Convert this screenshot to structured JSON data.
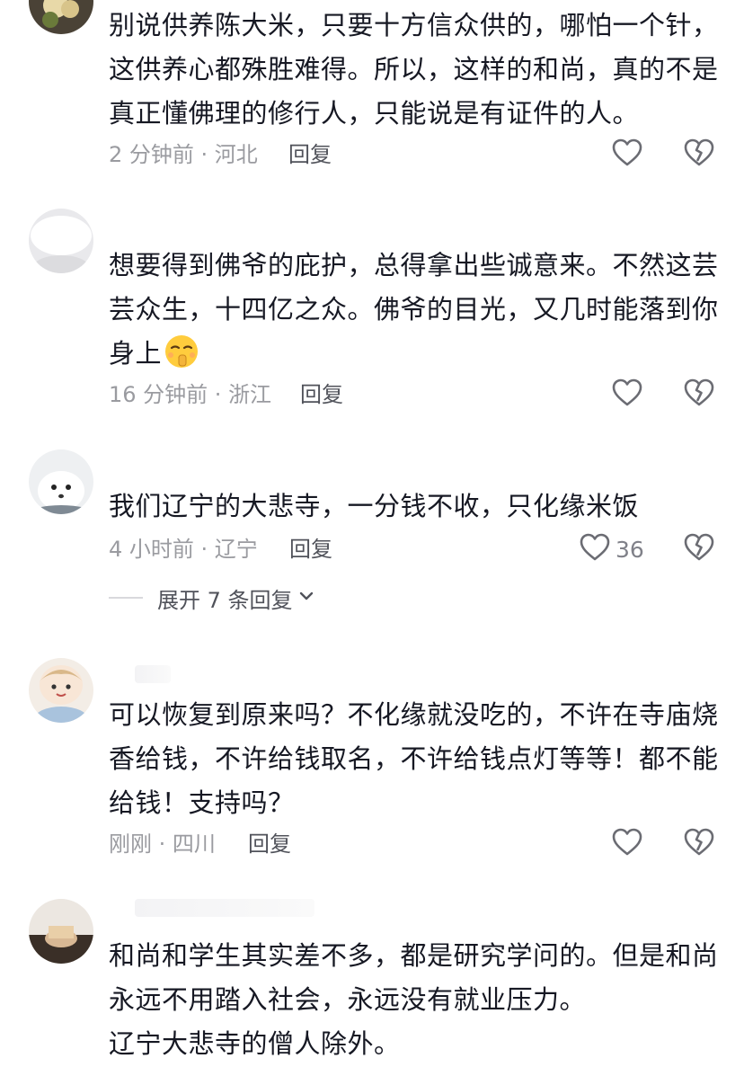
{
  "comments": [
    {
      "lines": [
        "别说供养陈大米，只要十方信众供的，哪怕一个针，",
        "这供养心都殊胜难得。所以，这样的和尚，真的不是",
        "真正懂佛理的修行人，只能说是有证件的人。"
      ],
      "time": "2 分钟前",
      "location": "河北",
      "reply_label": "回复",
      "like_count": ""
    },
    {
      "lines": [
        "想要得到佛爷的庇护，总得拿出些诚意来。不然这芸",
        "芸众生，十四亿之众。佛爷的目光，又几时能落到你",
        "身上"
      ],
      "emoji": "shushing-face-emoji",
      "time": "16 分钟前",
      "location": "浙江",
      "reply_label": "回复",
      "like_count": ""
    },
    {
      "lines": [
        "我们辽宁的大悲寺，一分钱不收，只化缘米饭"
      ],
      "time": "4 小时前",
      "location": "辽宁",
      "reply_label": "回复",
      "like_count": "36",
      "expand_label": "展开 7 条回复"
    },
    {
      "lines": [
        "可以恢复到原来吗？不化缘就没吃的，不许在寺庙烧",
        "香给钱，不许给钱取名，不许给钱点灯等等！都不能",
        "给钱！支持吗？"
      ],
      "time": "刚刚",
      "location": "四川",
      "reply_label": "回复",
      "like_count": ""
    },
    {
      "lines": [
        "和尚和学生其实差不多，都是研究学问的。但是和尚",
        "永远不用踏入社会，永远没有就业压力。",
        "辽宁大悲寺的僧人除外。"
      ]
    }
  ],
  "separator": " · ",
  "colors": {
    "text": "#161823",
    "meta": "#9a9ba0",
    "reply": "#50525a",
    "icon": "#6b6c73"
  }
}
